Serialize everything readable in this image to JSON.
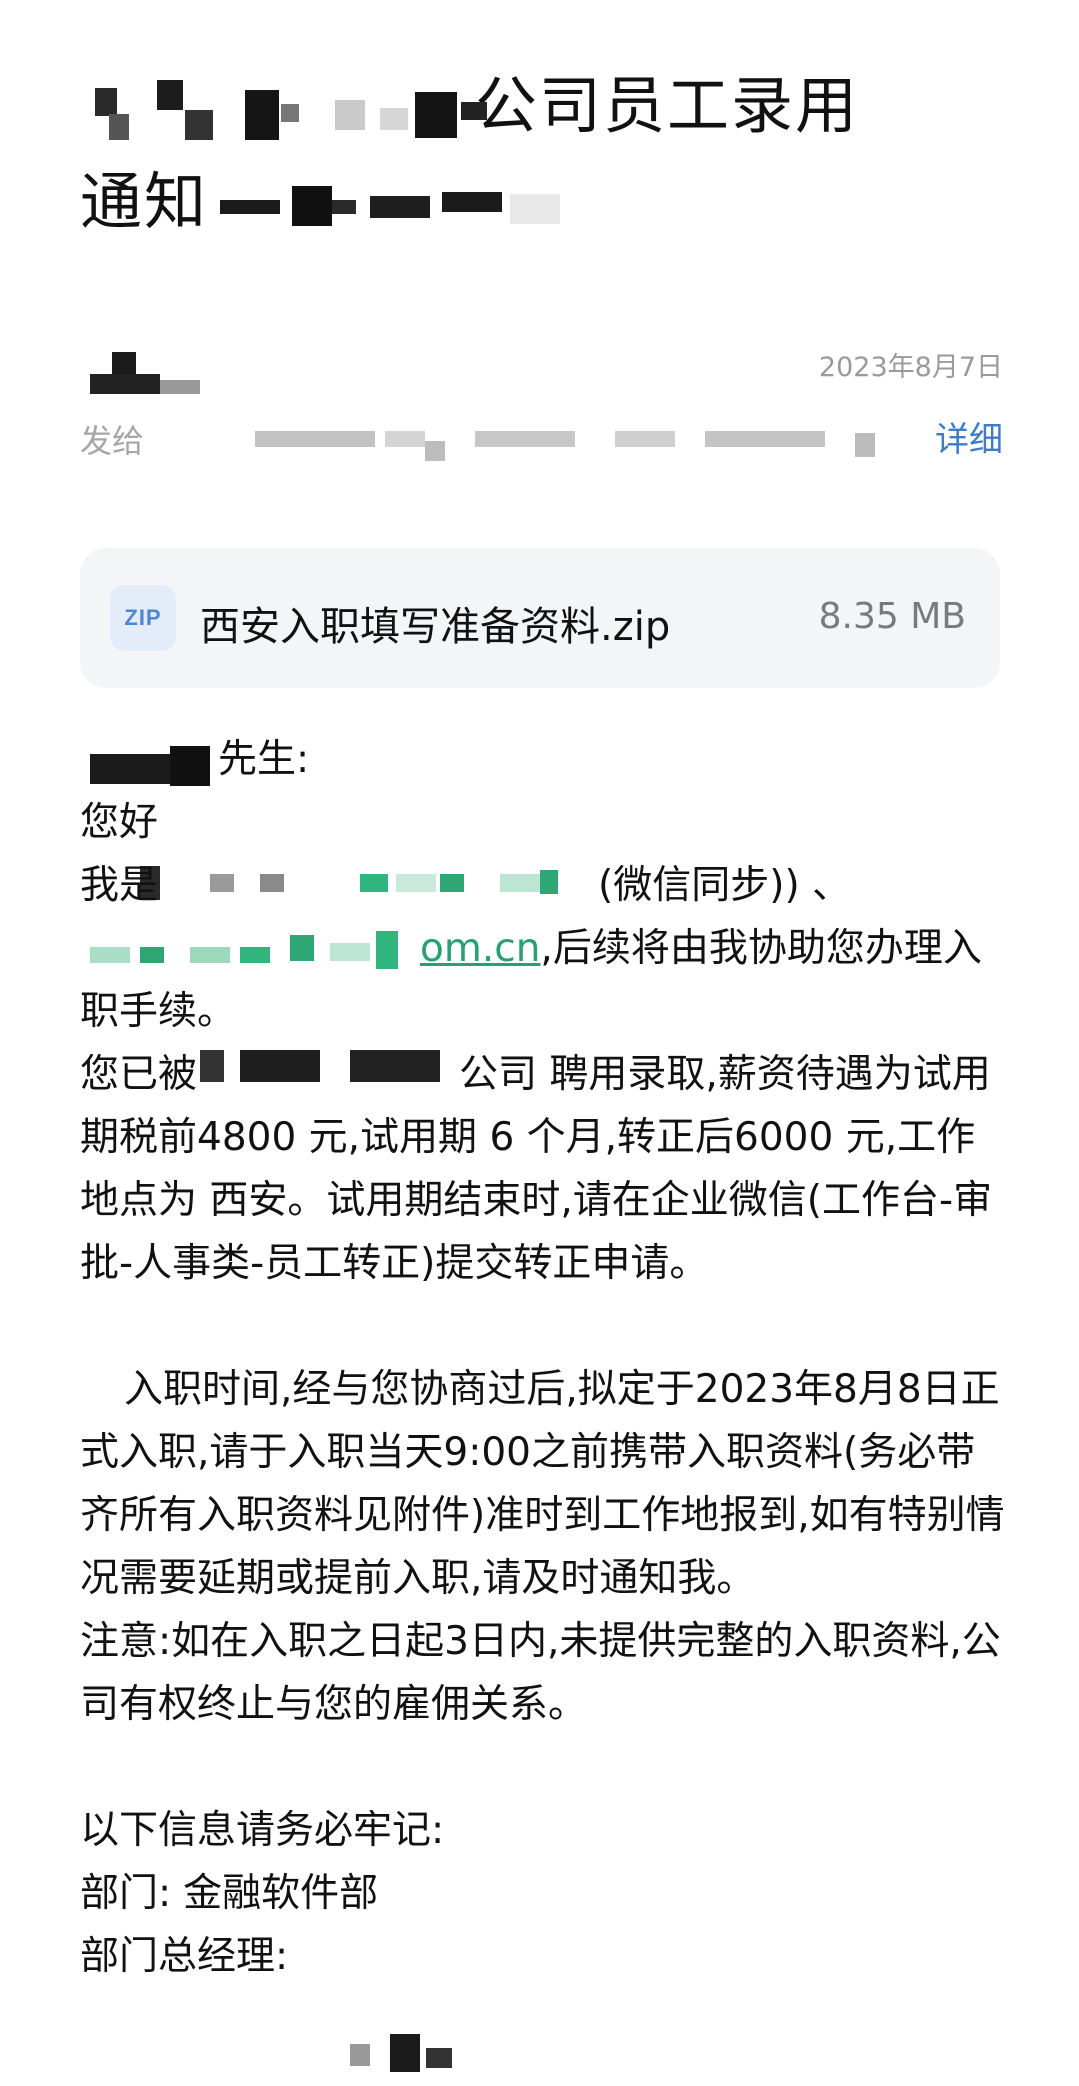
{
  "email": {
    "subject_line1": "公司员工录用",
    "subject_line2_prefix": "通知",
    "date": "2023年8月7日",
    "to_label": "发给",
    "detail_link": "详细"
  },
  "attachment": {
    "icon_label": "ZIP",
    "name": "西安入职填写准备资料.zip",
    "size": "8.35 MB"
  },
  "body": {
    "greeting_suffix": "先生:",
    "hello": "您好",
    "intro_prefix": "我是",
    "intro_wechat": "(微信同步)) 、",
    "email_domain_suffix": "om.cn",
    "intro_rest": ",后续将由我协助您办理入职手续。",
    "offer_prefix": "您已被",
    "offer_text": "公司 聘用录取,薪资待遇为试用期税前4800 元,试用期 6 个月,转正后6000 元,工作地点为 西安。试用期结束时,请在企业微信(工作台-审批-人事类-员工转正)提交转正申请。",
    "onboarding_text": "入职时间,经与您协商过后,拟定于2023年8月8日正式入职,请于入职当天9:00之前携带入职资料(务必带齐所有入职资料见附件)准时到工作地报到,如有特别情况需要延期或提前入职,请及时通知我。",
    "notice_text": "注意:如在入职之日起3日内,未提供完整的入职资料,公司有权终止与您的雇佣关系。",
    "remember_heading": "以下信息请务必牢记:",
    "department_label": "部门:",
    "department_value": "金融软件部",
    "manager_label": "部门总经理:"
  },
  "colors": {
    "link": "#3f7cc8",
    "email_link": "#28a071",
    "muted": "#9a9a9a",
    "card_bg": "#f4f5f7"
  }
}
